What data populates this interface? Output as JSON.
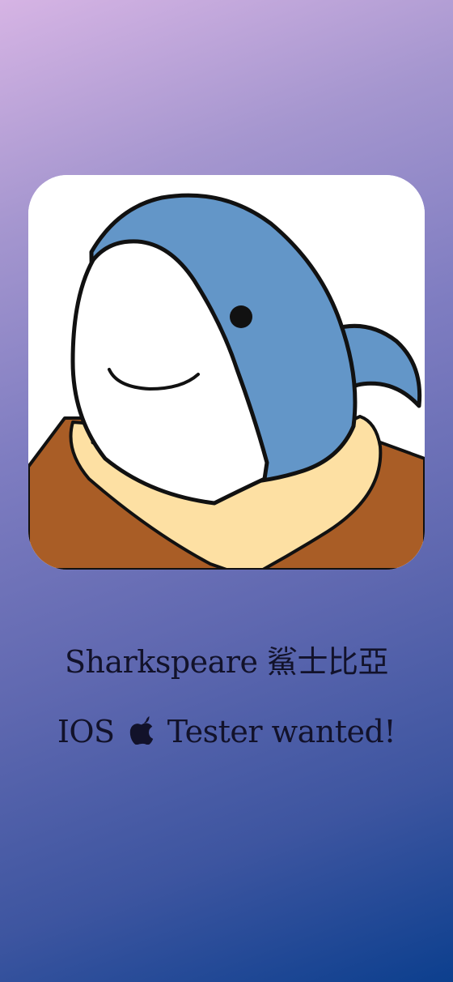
{
  "app": {
    "name": "Sharkspeare 鯊士比亞",
    "tester_prefix": "IOS",
    "tester_icon": "apple-icon",
    "tester_suffix": "Tester wanted!"
  },
  "colors": {
    "gradient_top": "#d6b4e4",
    "gradient_bottom": "#0c3f8e",
    "shark_blue": "#6396c8",
    "coat_brown": "#a95d26",
    "collar_cream": "#fde0a3",
    "text": "#12122a"
  }
}
